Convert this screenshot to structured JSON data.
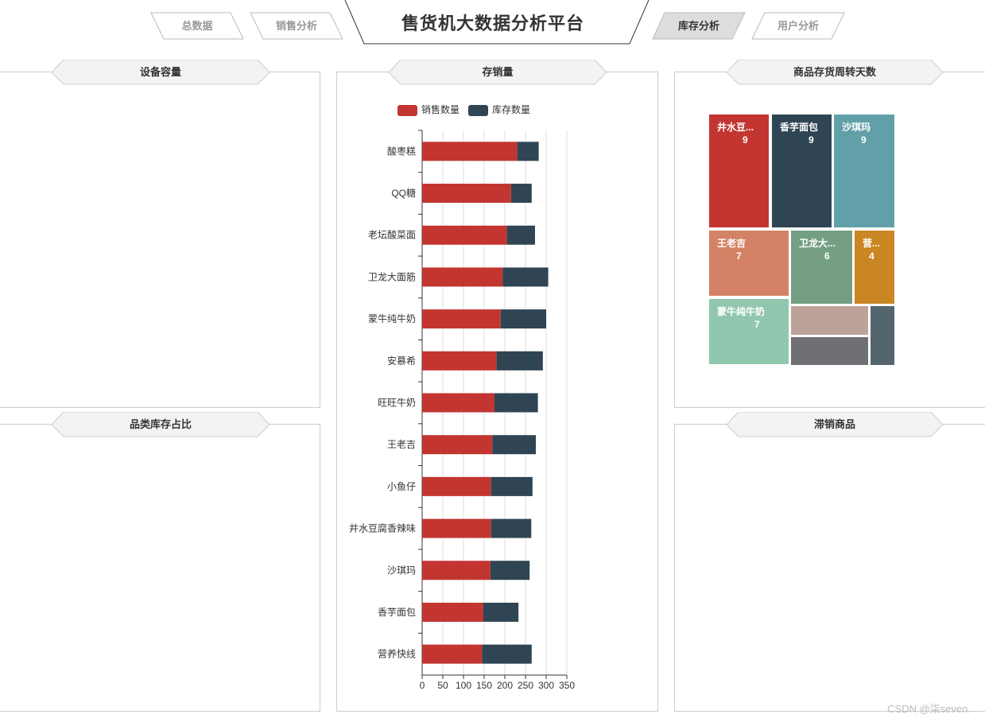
{
  "nav": {
    "title": "售货机大数据分析平台",
    "tabs": [
      {
        "label": "总数据",
        "active": false
      },
      {
        "label": "销售分析",
        "active": false
      },
      {
        "label": "库存分析",
        "active": true
      },
      {
        "label": "用户分析",
        "active": false
      }
    ]
  },
  "panels": {
    "capacity": {
      "title": "设备容量"
    },
    "stock_sales": {
      "title": "存销量"
    },
    "turnover": {
      "title": "商品存货周转天数"
    },
    "category_ratio": {
      "title": "品类库存占比"
    },
    "slow_moving": {
      "title": "滞销商品"
    }
  },
  "colors": {
    "sales": "#c23531",
    "stock": "#2f4554"
  },
  "chart_data": {
    "type": "bar",
    "orientation": "horizontal",
    "stacked": true,
    "categories": [
      "酸枣糕",
      "QQ糖",
      "老坛酸菜面",
      "卫龙大面筋",
      "蒙牛纯牛奶",
      "安慕希",
      "旺旺牛奶",
      "王老吉",
      "小鱼仔",
      "井水豆腐香辣味",
      "沙琪玛",
      "香芋面包",
      "营养快线"
    ],
    "series": [
      {
        "name": "销售数量",
        "values": [
          230,
          215,
          205,
          195,
          190,
          180,
          175,
          170,
          167,
          167,
          165,
          148,
          145
        ]
      },
      {
        "name": "库存数量",
        "values": [
          52,
          50,
          68,
          110,
          110,
          112,
          105,
          105,
          100,
          97,
          95,
          85,
          120
        ]
      }
    ],
    "xlim": [
      0,
      350
    ],
    "xticks": [
      "0",
      "50",
      "100",
      "150",
      "200",
      "250",
      "300",
      "350"
    ],
    "legend": "top"
  },
  "treemap": {
    "type": "treemap",
    "items": [
      {
        "name": "井水豆...",
        "value": "9",
        "color": "#c23531"
      },
      {
        "name": "香芋面包",
        "value": "9",
        "color": "#2f4554"
      },
      {
        "name": "沙琪玛",
        "value": "9",
        "color": "#61a0a8"
      },
      {
        "name": "王老吉",
        "value": "7",
        "color": "#d48265"
      },
      {
        "name": "卫龙大...",
        "value": "6",
        "color": "#749f83"
      },
      {
        "name": "营...",
        "value": "4",
        "color": "#ca8622"
      },
      {
        "name": "蒙牛纯牛奶",
        "value": "7",
        "color": "#91c7ae"
      },
      {
        "name": "",
        "value": "",
        "color": "#bda29a"
      },
      {
        "name": "",
        "value": "",
        "color": "#6e7074"
      },
      {
        "name": "",
        "value": "",
        "color": "#546570"
      }
    ]
  },
  "watermark": "CSDN @柒seven."
}
